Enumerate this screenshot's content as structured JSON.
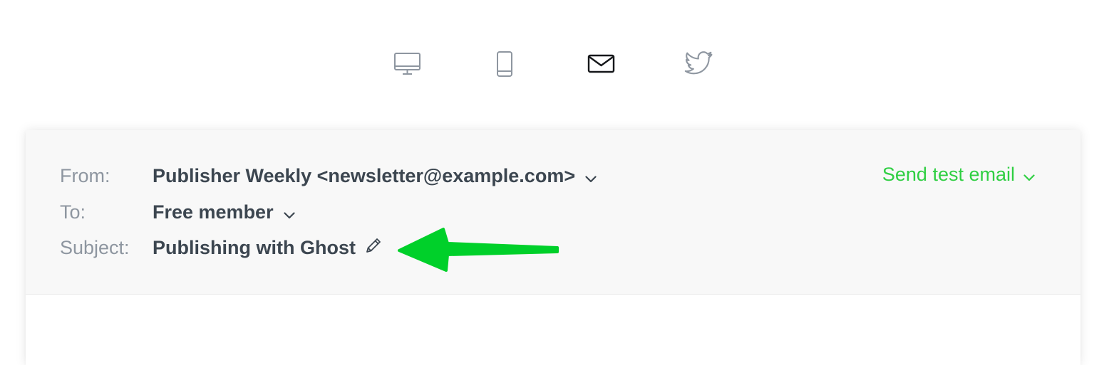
{
  "preview_modes": [
    {
      "name": "desktop",
      "icon": "desktop-monitor-icon",
      "active": false
    },
    {
      "name": "mobile",
      "icon": "mobile-phone-icon",
      "active": false
    },
    {
      "name": "email",
      "icon": "envelope-icon",
      "active": true
    },
    {
      "name": "twitter",
      "icon": "twitter-bird-icon",
      "active": false
    }
  ],
  "email_header": {
    "from_label": "From:",
    "from_value": "Publisher Weekly <newsletter@example.com>",
    "to_label": "To:",
    "to_value": "Free member",
    "subject_label": "Subject:",
    "subject_value": "Publishing with Ghost",
    "send_test_label": "Send test email"
  },
  "colors": {
    "accent_green": "#30cf43",
    "annotation_arrow": "#00d02a",
    "icon_inactive": "#8e96a0",
    "icon_active": "#15171a",
    "label_gray": "#8e96a0",
    "value_dark": "#3c4650"
  }
}
